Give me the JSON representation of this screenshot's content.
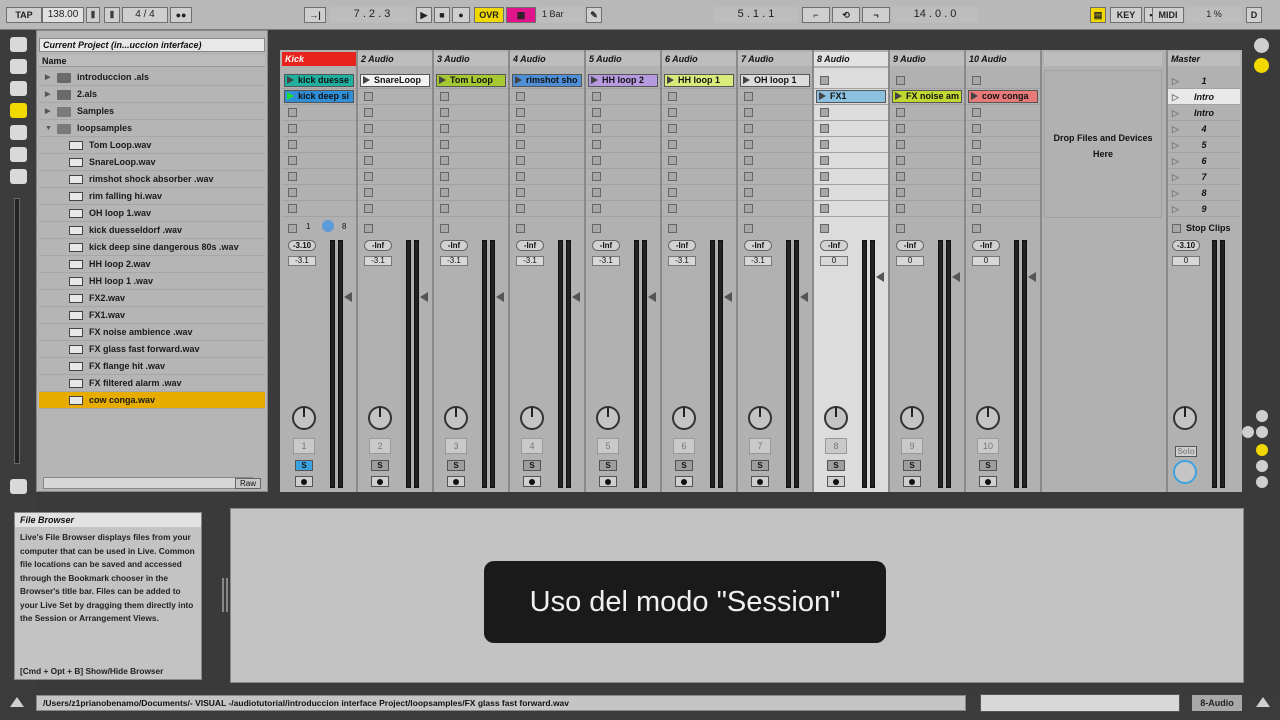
{
  "transport": {
    "tap": "TAP",
    "tempo": "138.00",
    "sig": "4 / 4",
    "arr_pos": "7 .  2 .  3",
    "ovr": "OVR",
    "quant": "1 Bar",
    "loop_start": "5 .  1 .  1",
    "loop_len": "14 .  0 .  0",
    "key": "KEY",
    "midi": "MIDI",
    "cpu": "1 %",
    "d": "D"
  },
  "browser": {
    "title": "Current Project (in...uccion interface)",
    "col": "Name",
    "items": [
      {
        "label": "introduccion .als",
        "kind": "file"
      },
      {
        "label": "2.als",
        "kind": "file"
      },
      {
        "label": "Samples",
        "kind": "folder"
      },
      {
        "label": "loopsamples",
        "kind": "folder-open"
      },
      {
        "label": "Tom Loop.wav",
        "kind": "wav"
      },
      {
        "label": "SnareLoop.wav",
        "kind": "wav"
      },
      {
        "label": "rimshot shock absorber .wav",
        "kind": "wav"
      },
      {
        "label": "rim falling hi.wav",
        "kind": "wav"
      },
      {
        "label": "OH loop 1.wav",
        "kind": "wav"
      },
      {
        "label": "kick duesseldorf  .wav",
        "kind": "wav"
      },
      {
        "label": "kick deep sine dangerous 80s  .wav",
        "kind": "wav"
      },
      {
        "label": "HH loop 2.wav",
        "kind": "wav"
      },
      {
        "label": "HH loop 1  .wav",
        "kind": "wav"
      },
      {
        "label": "FX2.wav",
        "kind": "wav"
      },
      {
        "label": "FX1.wav",
        "kind": "wav"
      },
      {
        "label": "FX noise ambience .wav",
        "kind": "wav"
      },
      {
        "label": "FX glass fast forward.wav",
        "kind": "wav"
      },
      {
        "label": "FX flange hit .wav",
        "kind": "wav"
      },
      {
        "label": "FX filtered alarm .wav",
        "kind": "wav"
      },
      {
        "label": "cow conga.wav",
        "kind": "wav",
        "selected": true
      }
    ],
    "raw": "Raw"
  },
  "tracks": [
    {
      "name": "Kick",
      "color": "#e8231e",
      "clips": [
        {
          "row": 0,
          "label": "kick duesse",
          "color": "#1fb0a0"
        },
        {
          "row": 1,
          "label": "kick deep si",
          "color": "#2f8fd8",
          "playing": true
        }
      ],
      "vol": "-3.10",
      "pan": "-3.1",
      "num": "1"
    },
    {
      "name": "2 Audio",
      "clips": [
        {
          "row": 0,
          "label": "SnareLoop",
          "color": "#f2f2f2"
        }
      ],
      "vol": "-Inf",
      "pan": "-3.1",
      "num": "2"
    },
    {
      "name": "3 Audio",
      "clips": [
        {
          "row": 0,
          "label": "Tom Loop",
          "color": "#a6c832"
        }
      ],
      "vol": "-Inf",
      "pan": "-3.1",
      "num": "3"
    },
    {
      "name": "4 Audio",
      "clips": [
        {
          "row": 0,
          "label": "rimshot sho",
          "color": "#4f8fd8"
        }
      ],
      "vol": "-Inf",
      "pan": "-3.1",
      "num": "4"
    },
    {
      "name": "5 Audio",
      "clips": [
        {
          "row": 0,
          "label": "HH loop 2",
          "color": "#b69ae0"
        }
      ],
      "vol": "-Inf",
      "pan": "-3.1",
      "num": "5"
    },
    {
      "name": "6 Audio",
      "clips": [
        {
          "row": 0,
          "label": "HH loop 1",
          "color": "#d8ec7c"
        }
      ],
      "vol": "-Inf",
      "pan": "-3.1",
      "num": "6"
    },
    {
      "name": "7 Audio",
      "clips": [
        {
          "row": 0,
          "label": "OH loop 1",
          "color": "#dcdcdc"
        }
      ],
      "vol": "-Inf",
      "pan": "-3.1",
      "num": "7"
    },
    {
      "name": "8 Audio",
      "clips": [
        {
          "row": 1,
          "label": "FX1",
          "color": "#8cc0e0"
        }
      ],
      "vol": "-Inf",
      "pan": "0",
      "num": "8"
    },
    {
      "name": "9 Audio",
      "clips": [
        {
          "row": 1,
          "label": "FX noise am",
          "color": "#c0d830"
        }
      ],
      "vol": "-Inf",
      "pan": "0",
      "num": "9"
    },
    {
      "name": "10 Audio",
      "clips": [
        {
          "row": 1,
          "label": "cow conga",
          "color": "#e87a7a"
        }
      ],
      "vol": "-Inf",
      "pan": "0",
      "num": "10"
    }
  ],
  "drop_zone": "Drop Files and Devices Here",
  "master": {
    "name": "Master",
    "vol": "-3.10",
    "pan": "0",
    "stop": "Stop Clips",
    "solo": "Solo"
  },
  "scenes": [
    "1",
    "Intro",
    "Intro",
    "4",
    "5",
    "6",
    "7",
    "8",
    "9"
  ],
  "sbutton": "S",
  "track1_extra": {
    "a": "1",
    "b": "8"
  },
  "info": {
    "title": "File Browser",
    "text": "Live's File Browser displays files from your computer that can be used in Live. Common file locations can be saved and accessed through the Bookmark chooser in the Browser's title bar. Files can be added to your Live Set by dragging them directly into the Session or Arrangement Views.",
    "shortcut": "[Cmd + Opt + B] Show/Hide Browser"
  },
  "overlay": "Uso del modo \"Session\"",
  "status": {
    "path": "/Users/z1prianobenamo/Documents/- VISUAL -/audiotutorial/introduccion  interface Project/loopsamples/FX glass fast forward.wav",
    "track": "8-Audio"
  }
}
